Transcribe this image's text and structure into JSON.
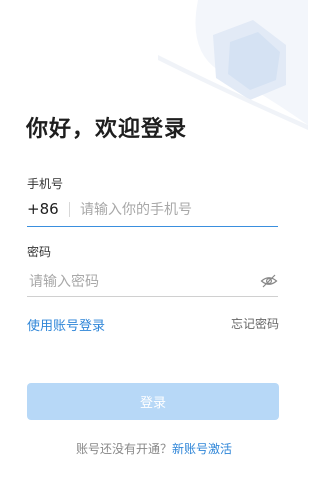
{
  "greeting": "你好，欢迎登录",
  "phone": {
    "label": "手机号",
    "country_code": "+86",
    "placeholder": "请输入你的手机号",
    "value": ""
  },
  "password": {
    "label": "密码",
    "placeholder": "请输入密码",
    "value": "",
    "toggle_icon": "eye-off-icon"
  },
  "links": {
    "account_login": "使用账号登录",
    "forgot_password": "忘记密码"
  },
  "login_button": {
    "label": "登录"
  },
  "footer": {
    "prompt": "账号还没有开通？",
    "activate": "新账号激活"
  },
  "colors": {
    "accent": "#2f86d8",
    "button_disabled": "#b7d8f7",
    "active_underline": "#3a8fde"
  }
}
